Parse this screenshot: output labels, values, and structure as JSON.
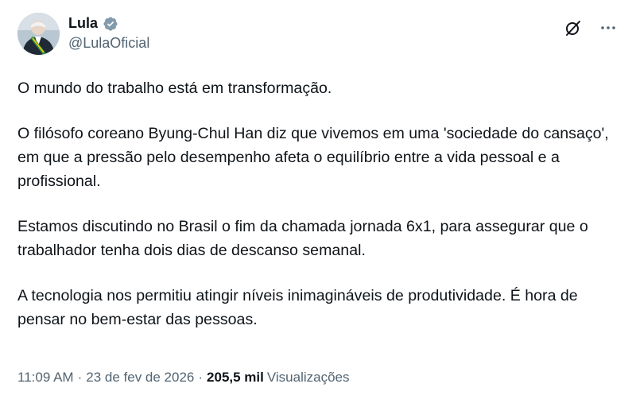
{
  "author": {
    "display_name": "Lula",
    "handle": "@LulaOficial",
    "verified": true,
    "verified_color": "#829aab"
  },
  "icons": {
    "avatar": "profile-photo",
    "verified": "verified-badge-icon",
    "grok": "grok-icon",
    "more": "more-options-icon"
  },
  "tweet": {
    "paragraphs": [
      "O mundo do trabalho está em transformação.",
      "O filósofo coreano Byung-Chul Han diz que vivemos em uma 'sociedade do cansaço', em que a pressão pelo desempenho afeta o equilíbrio entre a vida pessoal e a profissional.",
      "Estamos discutindo no Brasil o fim da chamada jornada 6x1, para assegurar que o trabalhador tenha dois dias de descanso semanal.",
      "A tecnologia nos permitiu atingir níveis inimagináveis de produtividade. É hora de pensar no bem-estar das pessoas."
    ]
  },
  "meta": {
    "time": "11:09 AM",
    "separator": "·",
    "date": "23 de fev de 2026",
    "views_count": "205,5 mil",
    "views_label": "Visualizações"
  }
}
